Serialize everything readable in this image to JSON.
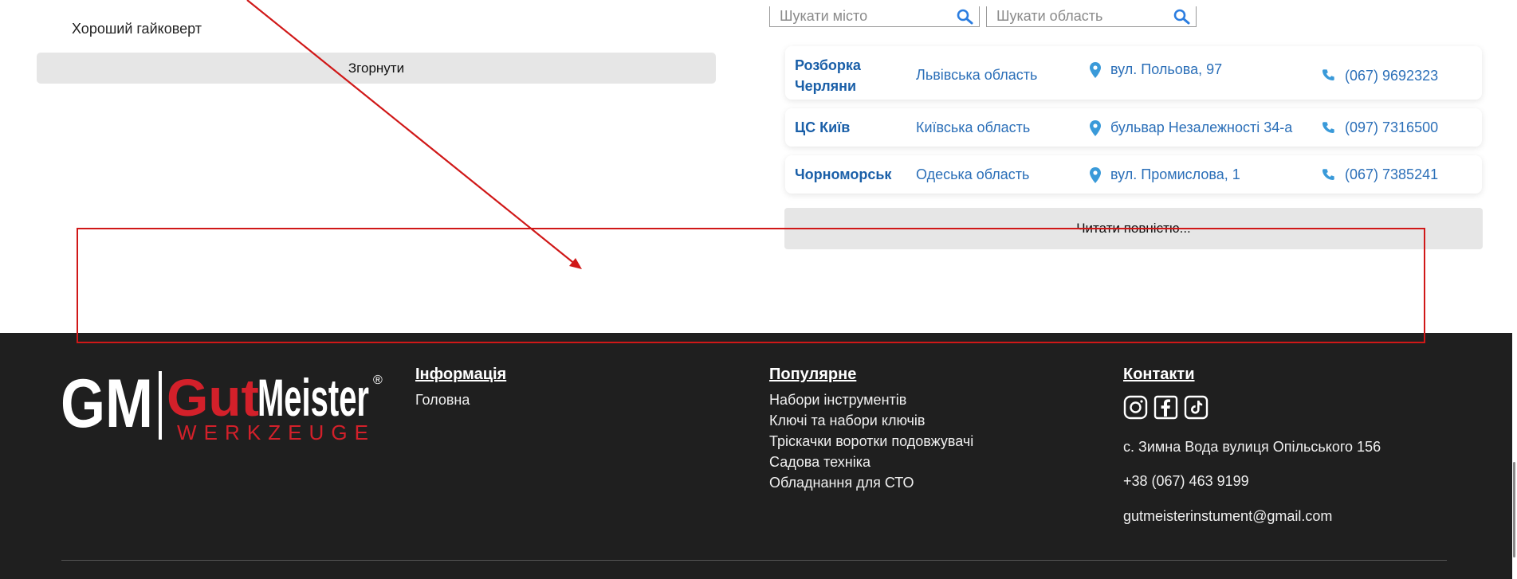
{
  "left_panel": {
    "item_text": "Хороший гайковерт",
    "collapse_label": "Згорнути"
  },
  "search": {
    "city_placeholder": "Шукати місто",
    "region_placeholder": "Шукати область"
  },
  "stores": [
    {
      "name_line1": "Розборка",
      "name_line2": "Черляни",
      "region": "Львівська область",
      "address": "вул. Польова, 97",
      "phone": "(067) 9692323"
    },
    {
      "name_line1": "ЦС Київ",
      "region": "Київська область",
      "address": "бульвар Незалежності 34-а",
      "phone": "(097) 7316500"
    },
    {
      "name_line1": "Чорноморськ",
      "region": "Одеська область",
      "address": "вул. Промислова, 1",
      "phone": "(067) 7385241"
    }
  ],
  "read_more_label": "Читати повністю...",
  "footer": {
    "logo": {
      "left": "GM",
      "brand": "GutMeister",
      "sub": "WERKZEUGE",
      "reg": "®"
    },
    "info": {
      "heading": "Інформація",
      "links": [
        "Головна"
      ]
    },
    "popular": {
      "heading": "Популярне",
      "links": [
        "Набори інструментів",
        "Ключі та набори ключів",
        "Тріскачки воротки подовжувачі",
        "Садова техніка",
        "Обладнання для СТО"
      ]
    },
    "contacts": {
      "heading": "Контакти",
      "social_icons": [
        "instagram-icon",
        "facebook-icon",
        "tiktok-icon"
      ],
      "address": "с. Зимна Вода вулиця Опільського 156",
      "phone": "+38 (067) 463 9199",
      "email": "gutmeisterinstument@gmail.com"
    }
  },
  "colors": {
    "link_blue": "#2b6fb8",
    "name_blue": "#1a5fa8",
    "icon_blue": "#3a9ad9",
    "footer_bg": "#1f1f1f",
    "logo_red": "#d3202a",
    "annotation_red": "#d01818"
  }
}
